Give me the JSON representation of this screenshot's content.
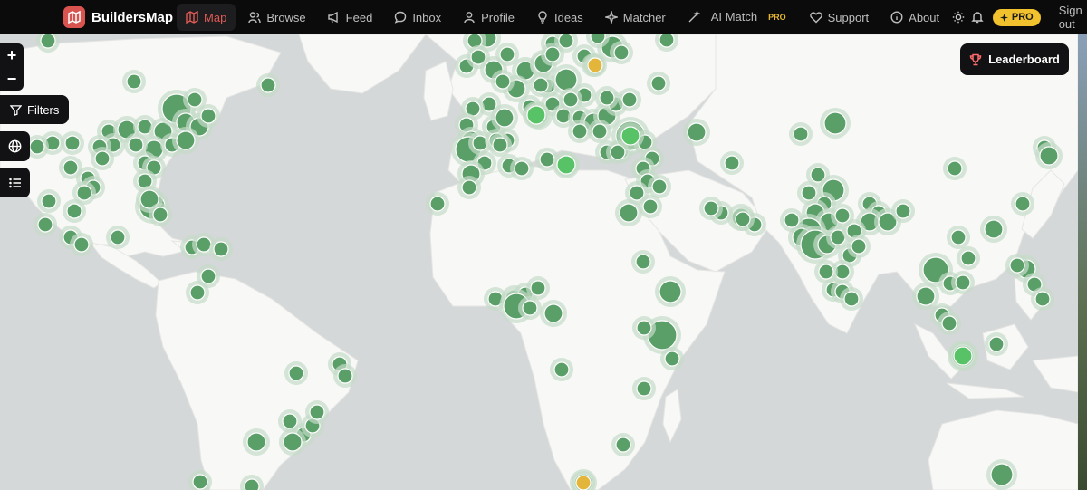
{
  "brand": {
    "name": "BuildersMap",
    "logo_icon": "map-icon"
  },
  "nav": [
    {
      "label": "Map",
      "icon": "map-icon",
      "active": true
    },
    {
      "label": "Browse",
      "icon": "users-icon"
    },
    {
      "label": "Feed",
      "icon": "megaphone-icon"
    },
    {
      "label": "Inbox",
      "icon": "chat-icon"
    },
    {
      "label": "Profile",
      "icon": "user-icon"
    },
    {
      "label": "Ideas",
      "icon": "lightbulb-icon"
    },
    {
      "label": "Matcher",
      "icon": "sparkle-icon"
    }
  ],
  "ai_match": {
    "line1": "AI",
    "line2": "Match",
    "badge": "PRO"
  },
  "nav_right": [
    {
      "label": "Support",
      "icon": "heart-icon"
    },
    {
      "label": "About",
      "icon": "info-icon"
    }
  ],
  "pro_button": {
    "label": "PRO",
    "icon": "sparkle-icon"
  },
  "signout_label": "Sign out",
  "map_controls": {
    "zoom_in": "+",
    "zoom_out": "−",
    "filters_label": "Filters",
    "leaderboard_label": "Leaderboard"
  },
  "colors": {
    "marker": "#5a9f68",
    "marker_halo": "#c4dcc8",
    "marker_bright": "#57c266",
    "marker_gold": "#e3b53a",
    "land": "#f8f8f7",
    "water": "#d5d8d9",
    "accent": "#e05a55"
  }
}
